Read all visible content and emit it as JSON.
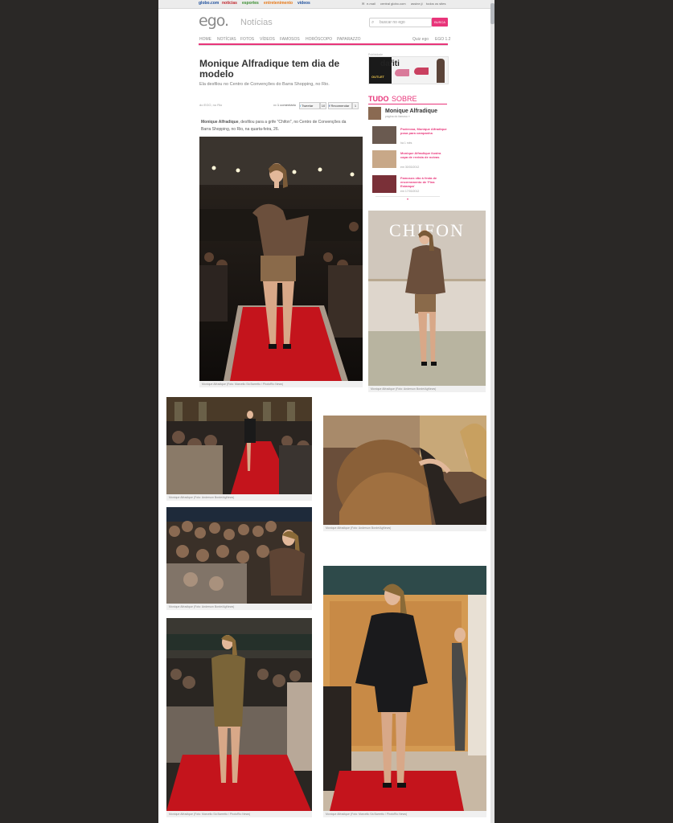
{
  "topbar": {
    "links": [
      "globo.com",
      "notícias",
      "esportes",
      "entretenimento",
      "vídeos"
    ],
    "link_colors": [
      "#1e4f9c",
      "#c0272d",
      "#3a8d2f",
      "#e77817",
      "#1e4f9c"
    ],
    "right_links": [
      "e-mail",
      "central globo.com",
      "assine.ji",
      "todos os sites"
    ]
  },
  "header": {
    "logo": "ego.",
    "section": "Notícias",
    "search_placeholder": "buscar no ego",
    "search_button": "BUSCA"
  },
  "nav": {
    "items": [
      "HOME",
      "NOTÍCIAS",
      "FOTOS",
      "VÍDEOS",
      "FAMOSOS",
      "HORÓSCOPO",
      "PAPARAZZO"
    ],
    "right_items": [
      "Quiz ego",
      "EGO 1.2"
    ]
  },
  "article": {
    "headline": "Monique Alfradique tem dia de modelo",
    "subtitle": "Ela desfilou no Centro de Convenções do Barra Shopping, no Rio.",
    "byline": "do EGO, no Rio",
    "comments": "1 comentário",
    "tweet_label": "Tweetar",
    "tweet_count": "10",
    "fb_label": "Recomendar",
    "fb_count": "1",
    "intro_bold": "Monique Alfradique",
    "intro_text": ", desfilou para a grife \"Chifon\", no Centro de Convenções da Barra Shopping, no Rio, na quarta-feira, 26."
  },
  "photos": {
    "hero_caption": "Monique Alfradique (Foto: Marcello Sá Barretto / PhotoRio News)",
    "side_caption": "Monique Alfradique (Foto: Anderson Borde/AgNews)",
    "p1_caption": "Monique Alfradique (Foto: Anderson Borde/AgNews)",
    "p2_caption": "Monique Alfradique (Foto: Anderson Borde/AgNews)",
    "p3_caption": "Monique Alfradique (Foto: Anderson Borde/AgNews)",
    "p4_caption": "Monique Alfradique (Foto: Marcello Sá Barretto / PhotoRio News)",
    "p5_caption": "Monique Alfradique (Foto: Marcello Sá Barretto / PhotoRio News)",
    "chifon_sign": "CHIFON"
  },
  "sidebar": {
    "ad_label": "Publicidade",
    "ad_brand": "dafiti",
    "ad_tag": "OUTLET",
    "tudo": "TUDO",
    "sobre": "SOBRE",
    "person_name": "Monique Alfradique",
    "person_sub": "página do famoso »",
    "related": [
      {
        "title": "Poderosa, Monique Alfradique posa para campanha",
        "date": "há 1 mês"
      },
      {
        "title": "Monique Alfradique ilustra capa de revista de noivas",
        "date": "em 30/03/2012"
      },
      {
        "title": "Famosos vão à festa de encerramento de 'Fina Estampa'",
        "date": "em 17/03/2012"
      }
    ],
    "more": "▾"
  },
  "colors": {
    "accent": "#e8357a",
    "runway_red": "#c4141c"
  }
}
